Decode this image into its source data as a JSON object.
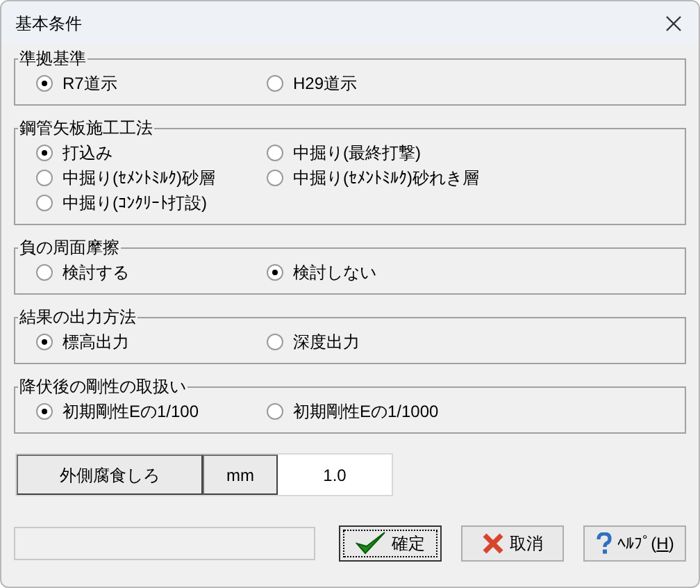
{
  "window": {
    "title": "基本条件"
  },
  "groups": [
    {
      "title": "準拠基準",
      "options": [
        {
          "label": "R7道示",
          "selected": true
        },
        {
          "label": "H29道示",
          "selected": false
        }
      ]
    },
    {
      "title": "鋼管矢板施工工法",
      "options": [
        {
          "label": "打込み",
          "selected": true
        },
        {
          "label": "中掘り(最終打撃)",
          "selected": false
        },
        {
          "label": "中掘り(ｾﾒﾝﾄﾐﾙｸ)砂層",
          "selected": false
        },
        {
          "label": "中掘り(ｾﾒﾝﾄﾐﾙｸ)砂れき層",
          "selected": false
        },
        {
          "label": "中掘り(ｺﾝｸﾘｰﾄ打設)",
          "selected": false
        }
      ]
    },
    {
      "title": "負の周面摩擦",
      "options": [
        {
          "label": "検討する",
          "selected": false
        },
        {
          "label": "検討しない",
          "selected": true
        }
      ]
    },
    {
      "title": "結果の出力方法",
      "options": [
        {
          "label": "標高出力",
          "selected": true
        },
        {
          "label": "深度出力",
          "selected": false
        }
      ]
    },
    {
      "title": "降伏後の剛性の取扱い",
      "options": [
        {
          "label": "初期剛性Eの1/100",
          "selected": true
        },
        {
          "label": "初期剛性Eの1/1000",
          "selected": false
        }
      ]
    }
  ],
  "input_row": {
    "label": "外側腐食しろ",
    "unit": "mm",
    "value": "1.0"
  },
  "buttons": [
    {
      "kind": "ok",
      "label": "確定",
      "focused": true
    },
    {
      "kind": "cancel",
      "label": "取消",
      "focused": false
    },
    {
      "kind": "help",
      "label_parts": [
        "ﾍﾙﾌﾟ(",
        "H",
        ")"
      ],
      "focused": false
    }
  ]
}
